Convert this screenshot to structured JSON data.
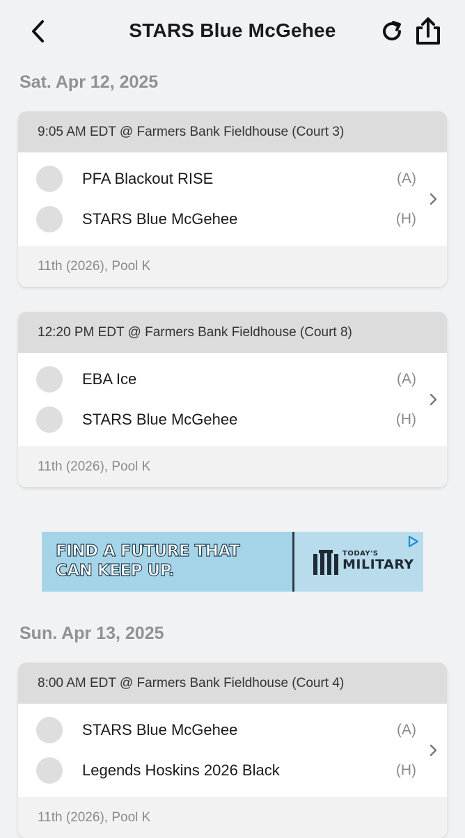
{
  "header": {
    "title": "STARS Blue McGehee",
    "back_icon": "chevron-left-icon",
    "refresh_icon": "refresh-icon",
    "share_icon": "share-icon"
  },
  "days": [
    {
      "date": "Sat. Apr 12, 2025",
      "games": [
        {
          "time_location": "9:05 AM EDT @ Farmers Bank Fieldhouse (Court 3)",
          "teams": [
            {
              "name": "PFA Blackout RISE",
              "side": "(A)"
            },
            {
              "name": "STARS Blue McGehee",
              "side": "(H)"
            }
          ],
          "division": "11th (2026), Pool K"
        },
        {
          "time_location": "12:20 PM EDT @ Farmers Bank Fieldhouse (Court 8)",
          "teams": [
            {
              "name": "EBA Ice",
              "side": "(A)"
            },
            {
              "name": "STARS Blue McGehee",
              "side": "(H)"
            }
          ],
          "division": "11th (2026), Pool K"
        }
      ]
    },
    {
      "date": "Sun. Apr 13, 2025",
      "games": [
        {
          "time_location": "8:00 AM EDT @ Farmers Bank Fieldhouse (Court 4)",
          "teams": [
            {
              "name": "STARS Blue McGehee",
              "side": "(A)"
            },
            {
              "name": "Legends Hoskins 2026 Black",
              "side": "(H)"
            }
          ],
          "division": "11th (2026), Pool K"
        }
      ]
    }
  ],
  "ad": {
    "headline_line1": "FIND A FUTURE THAT",
    "headline_line2": "CAN KEEP UP.",
    "brand_line1": "TODAY'S",
    "brand_line2": "MILITARY",
    "choices_icon": "adchoices-icon"
  },
  "colors": {
    "background": "#f1f2f4",
    "card_header": "#dcdcdc",
    "date_heading": "#8e9197",
    "ad_background": "#a7d6ea"
  }
}
